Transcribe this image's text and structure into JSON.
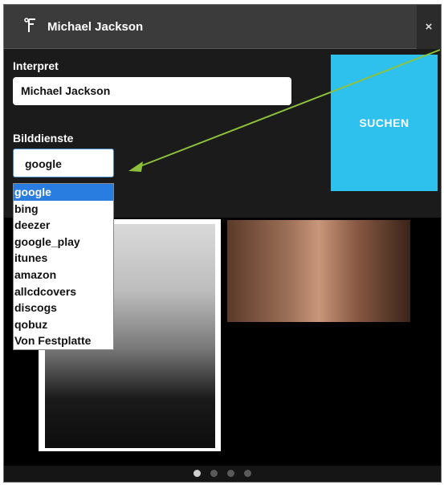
{
  "window": {
    "title": "Michael Jackson",
    "close_label": "×"
  },
  "form": {
    "interpret_label": "Interpret",
    "interpret_value": "Michael Jackson",
    "services_label": "Bilddienste",
    "services_selected": "google",
    "search_button": "SUCHEN"
  },
  "dropdown": {
    "options": [
      "google",
      "bing",
      "deezer",
      "google_play",
      "itunes",
      "amazon",
      "allcdcovers",
      "discogs",
      "qobuz",
      "Von Festplatte"
    ],
    "highlighted": "google"
  },
  "pagination": {
    "count": 4,
    "active_index": 0
  },
  "colors": {
    "accent": "#2fc1ee",
    "highlight": "#2a7de0",
    "arrow": "#8dc03b",
    "title_bar": "#3b3b3b"
  },
  "icons": {
    "title": "music-note-icon",
    "close": "close-icon"
  }
}
